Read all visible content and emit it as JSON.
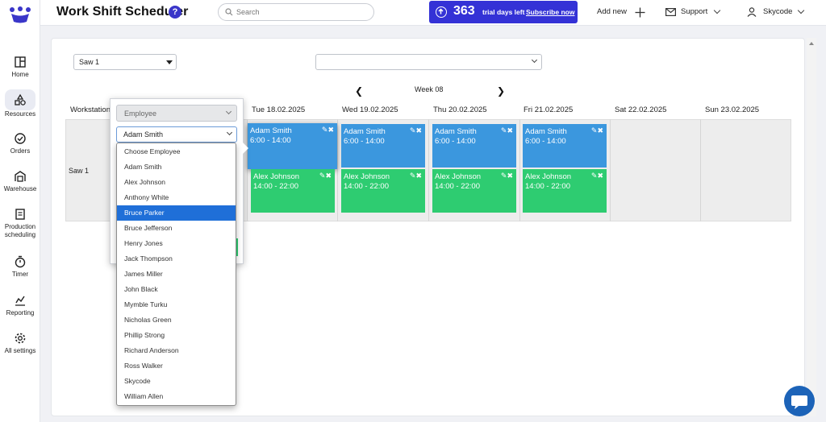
{
  "app": {
    "title": "Work Shift Scheduler",
    "help": "?"
  },
  "search": {
    "placeholder": "Search"
  },
  "trial": {
    "days": "363",
    "text": "trial days left",
    "subscribe": "Subscribe now"
  },
  "topbar": {
    "add_new": "Add new",
    "support": "Support",
    "user": "Skycode"
  },
  "sidebar": {
    "items": [
      {
        "label": "Home",
        "icon": "home-icon"
      },
      {
        "label": "Resources",
        "icon": "resources-icon",
        "active": true
      },
      {
        "label": "Orders",
        "icon": "check-circle-icon"
      },
      {
        "label": "Warehouse",
        "icon": "warehouse-icon"
      },
      {
        "label_1": "Production",
        "label_2": "scheduling",
        "icon": "document-icon"
      },
      {
        "label": "Timer",
        "icon": "timer-icon"
      },
      {
        "label": "Reporting",
        "icon": "chart-icon"
      },
      {
        "label": "All settings",
        "icon": "gear-icon"
      }
    ]
  },
  "filters": {
    "workstation_select": "Saw 1",
    "second_select": ""
  },
  "week": {
    "label": "Week 08"
  },
  "columns": {
    "workstation": "Workstation",
    "days": [
      "Tue 18.02.2025",
      "Wed 19.02.2025",
      "Thu 20.02.2025",
      "Fri 21.02.2025",
      "Sat 22.02.2025",
      "Sun 23.02.2025"
    ]
  },
  "row": {
    "workstation": "Saw 1"
  },
  "shifts": {
    "morning": {
      "name": "Adam Smith",
      "time": "6:00 - 14:00"
    },
    "afternoon": {
      "name": "Alex Johnson",
      "time": "14:00 - 22:00"
    }
  },
  "editor": {
    "type_select": "Employee",
    "employee_select": "Adam Smith",
    "options": [
      "Choose Employee",
      "Adam Smith",
      "Alex Johnson",
      "Anthony White",
      "Bruce Parker",
      "Bruce Jefferson",
      "Henry Jones",
      "Jack Thompson",
      "James Miller",
      "John Black",
      "Mymble Turku",
      "Nicholas Green",
      "Phillip Strong",
      "Richard Anderson",
      "Ross Walker",
      "Skycode",
      "William Allen"
    ],
    "highlighted": "Bruce Parker"
  },
  "colors": {
    "accent": "#3432d6",
    "shift_blue": "#3b97de",
    "shift_green": "#2ecc71",
    "selected": "#1f6fd8"
  }
}
